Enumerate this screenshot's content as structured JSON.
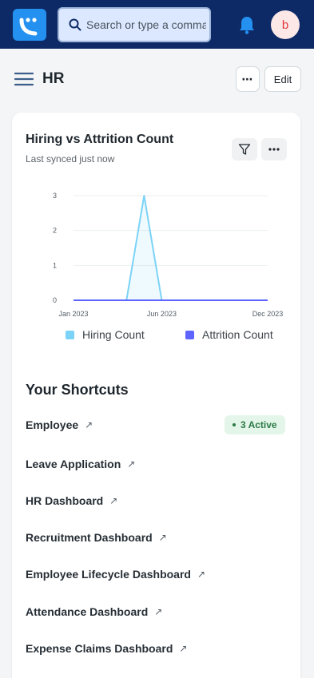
{
  "search": {
    "placeholder": "Search or type a command"
  },
  "user": {
    "avatar_initial": "b"
  },
  "page": {
    "title": "HR",
    "more_label": "⋯",
    "edit_label": "Edit"
  },
  "chart": {
    "title": "Hiring vs Attrition Count",
    "subtitle": "Last synced just now"
  },
  "chart_data": {
    "type": "line",
    "title": "Hiring vs Attrition Count",
    "x_tick_labels": [
      "Jan 2023",
      "Jun 2023",
      "Dec 2023"
    ],
    "y_tick_labels": [
      "0",
      "1",
      "2",
      "3"
    ],
    "ylim": [
      0,
      3
    ],
    "x": [
      "Jan 2023",
      "Feb 2023",
      "Mar 2023",
      "Apr 2023",
      "May 2023",
      "Jun 2023",
      "Jul 2023",
      "Aug 2023",
      "Sep 2023",
      "Oct 2023",
      "Nov 2023",
      "Dec 2023"
    ],
    "series": [
      {
        "name": "Hiring Count",
        "color": "#7cd3f7",
        "values": [
          0,
          0,
          0,
          0,
          3,
          0,
          0,
          0,
          0,
          0,
          0,
          0
        ]
      },
      {
        "name": "Attrition Count",
        "color": "#5e64ff",
        "values": [
          0,
          0,
          0,
          0,
          0,
          0,
          0,
          0,
          0,
          0,
          0,
          0
        ]
      }
    ],
    "grid": true,
    "legend": "bottom"
  },
  "shortcuts": {
    "title": "Your Shortcuts",
    "items": [
      {
        "label": "Employee",
        "arrow": "↗"
      },
      {
        "label": "Leave Application",
        "arrow": "↗"
      },
      {
        "label": "HR Dashboard",
        "arrow": "↗"
      },
      {
        "label": "Recruitment Dashboard",
        "arrow": "↗"
      },
      {
        "label": "Employee Lifecycle Dashboard",
        "arrow": "↗"
      },
      {
        "label": "Attendance Dashboard",
        "arrow": "↗"
      },
      {
        "label": "Expense Claims Dashboard",
        "arrow": "↗"
      }
    ],
    "employee_badge": "3 Active"
  }
}
